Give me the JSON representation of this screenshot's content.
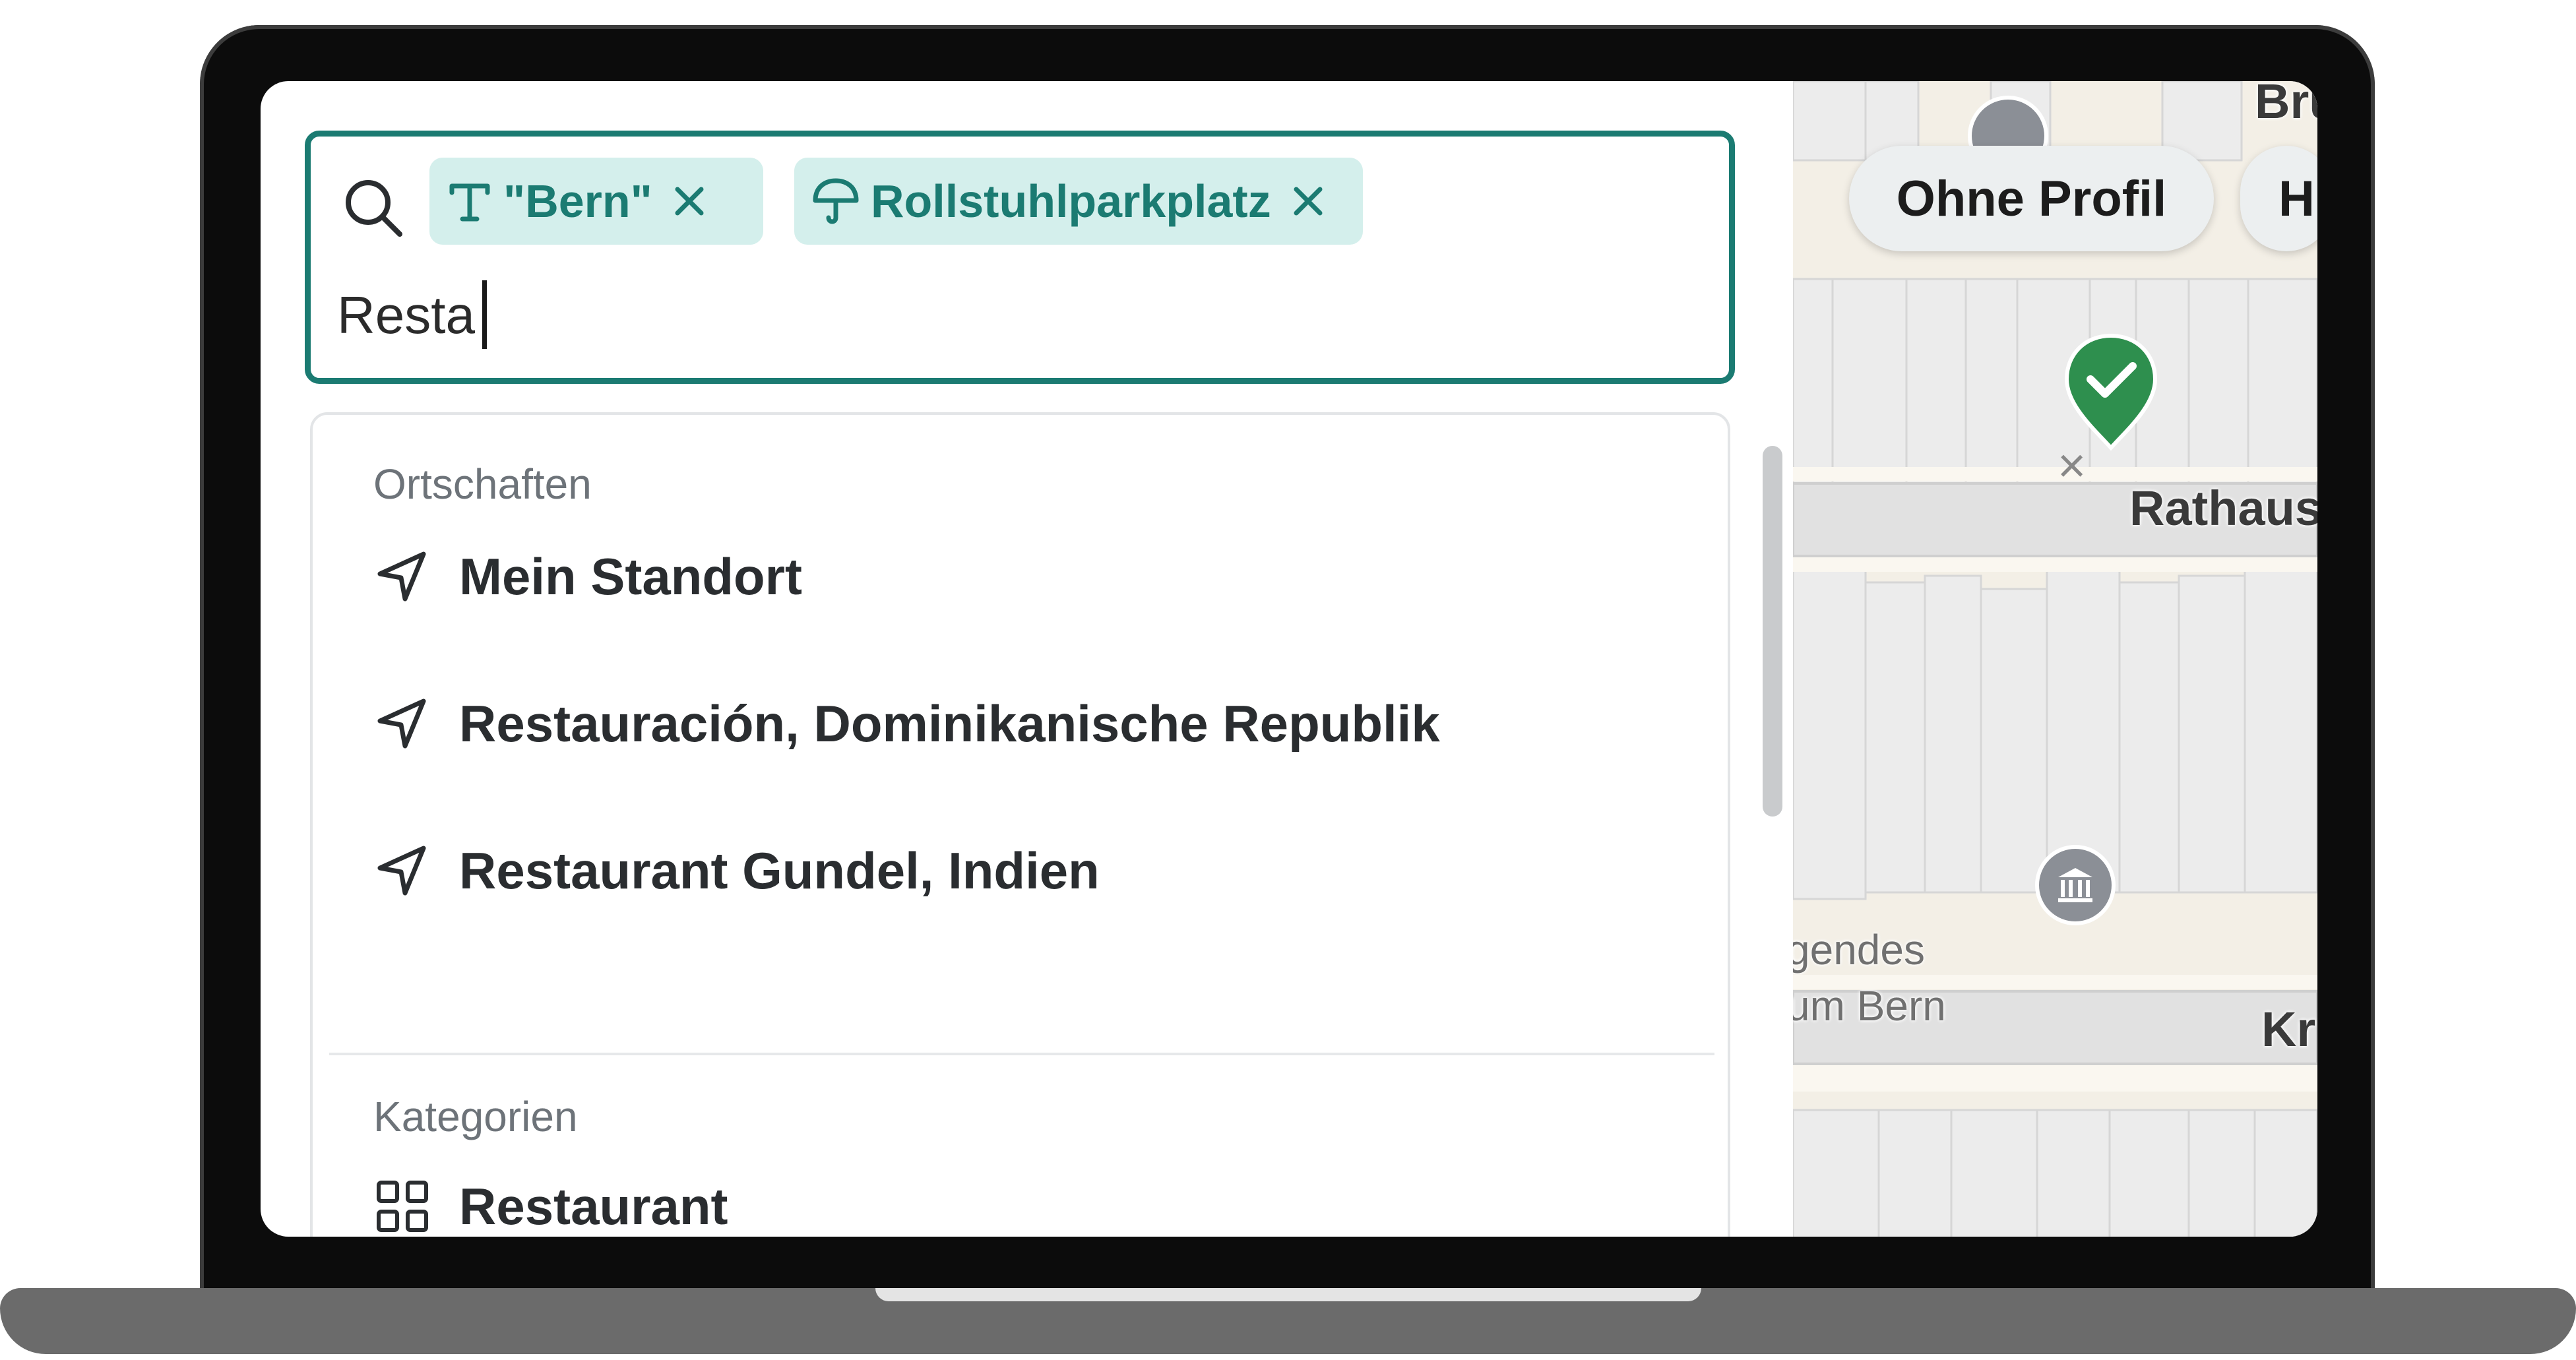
{
  "search": {
    "query": "Resta",
    "chips": [
      {
        "label": "\"Bern\"",
        "icon": "text-icon"
      },
      {
        "label": "Rollstuhlparkplatz",
        "icon": "umbrella-icon"
      }
    ]
  },
  "dropdown": {
    "sections": [
      {
        "title": "Ortschaften",
        "items": [
          {
            "label": "Mein Standort",
            "icon": "location-arrow-icon"
          },
          {
            "label": "Restauración, Dominikanische Republik",
            "icon": "location-arrow-icon"
          },
          {
            "label": "Restaurant Gundel, Indien",
            "icon": "location-arrow-icon"
          }
        ]
      },
      {
        "title": "Kategorien",
        "items": [
          {
            "label": "Restaurant",
            "icon": "grid-icon"
          }
        ]
      }
    ]
  },
  "map": {
    "profile_buttons": [
      "Ohne Profil",
      "H"
    ],
    "labels": {
      "top": "Brü",
      "street_1": "Rathaus",
      "street_2": "Kr",
      "poi_1": "gendes",
      "poi_2": "um Bern"
    }
  },
  "colors": {
    "accent": "#1b7b72",
    "chip_bg": "#d4efec",
    "pin": "#2e8f4e"
  }
}
